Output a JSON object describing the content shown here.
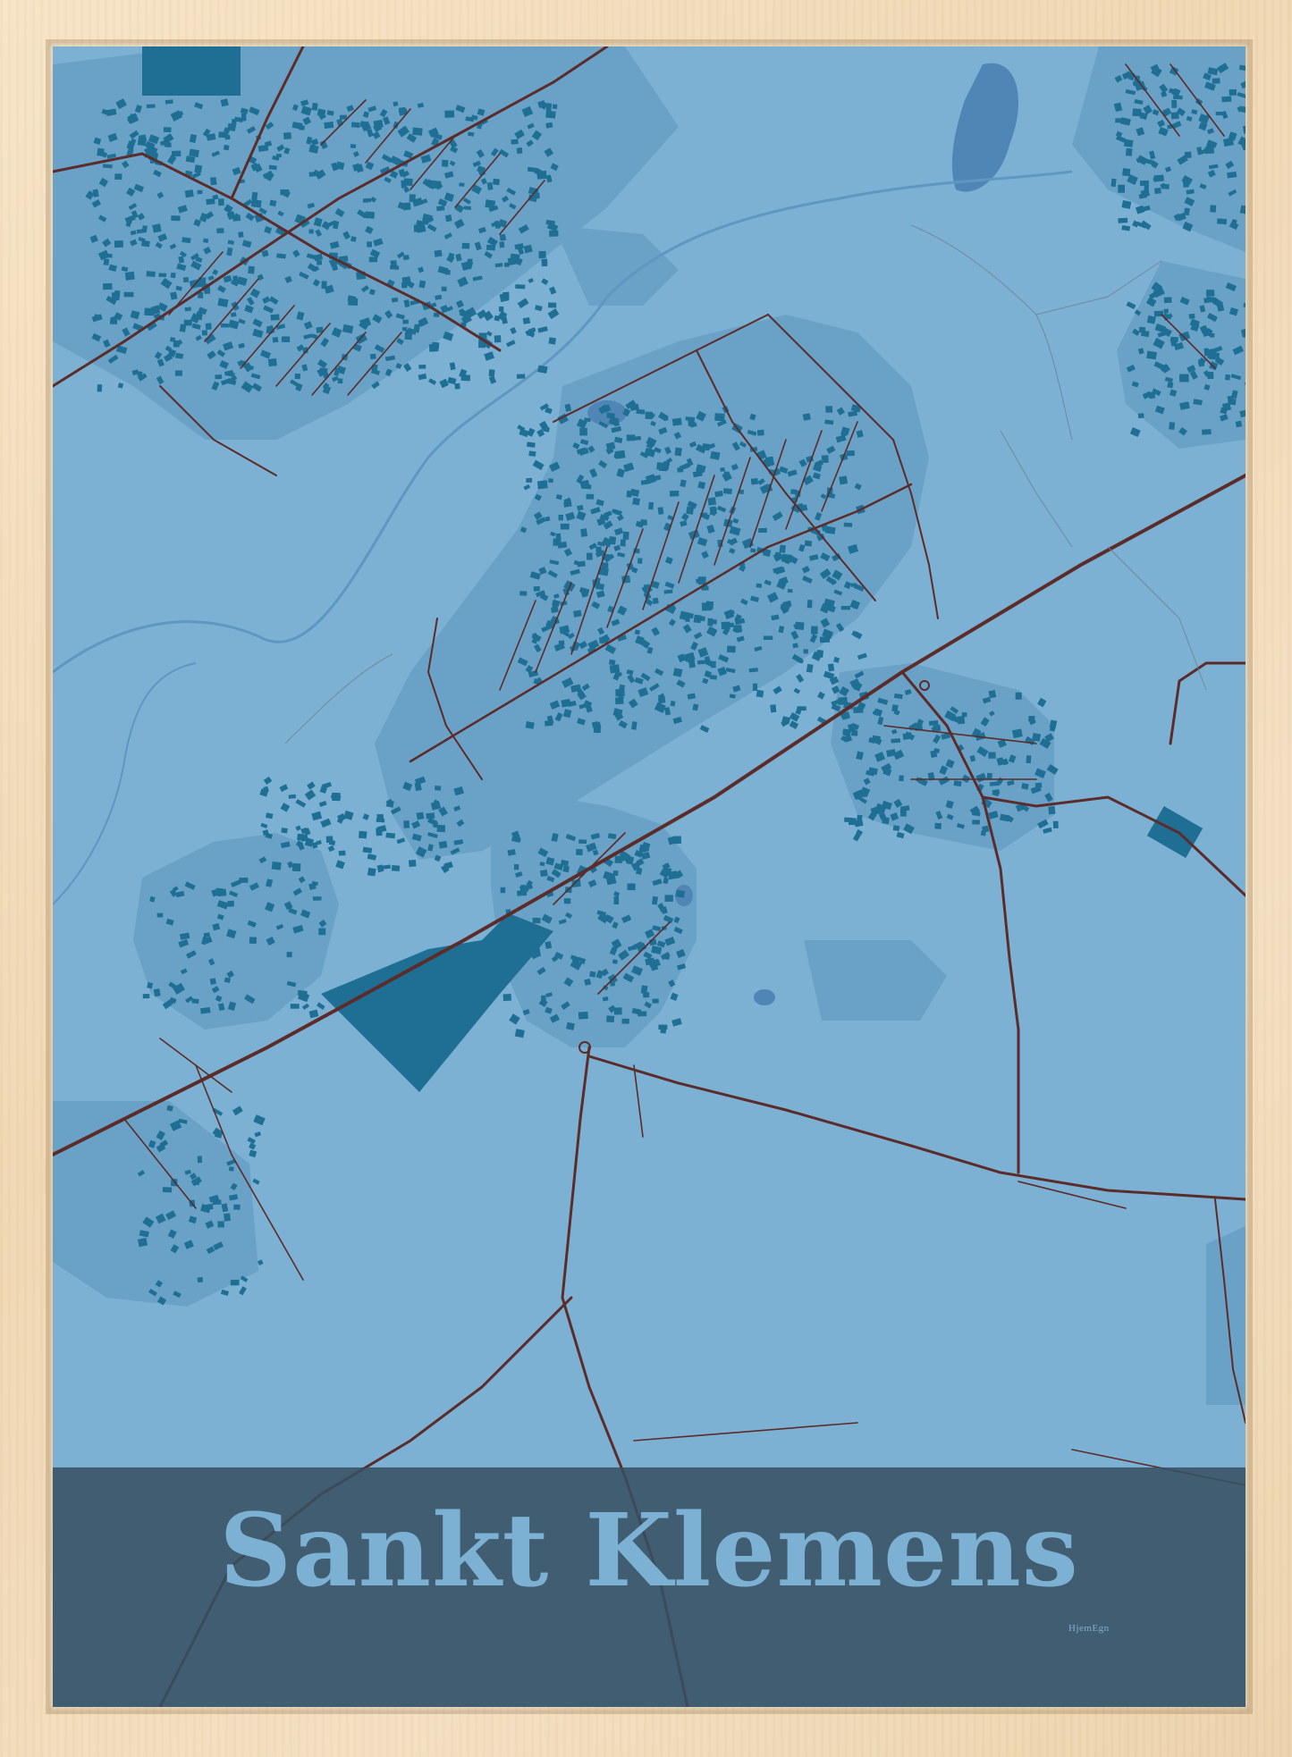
{
  "poster": {
    "title": "Sankt Klemens",
    "brand": "HjemEgn"
  },
  "colors": {
    "frame": "#f1ddbd",
    "map_background": "#7cb1d3",
    "residential_area": "#6aa1c6",
    "buildings": "#1f6e94",
    "water": "#4f86b5",
    "roads": "#5b2c2a",
    "title_band": "#3f5a6d",
    "title_text": "#7cb1d3"
  },
  "icons": {
    "frame": "wood-frame",
    "map": "street-map"
  }
}
